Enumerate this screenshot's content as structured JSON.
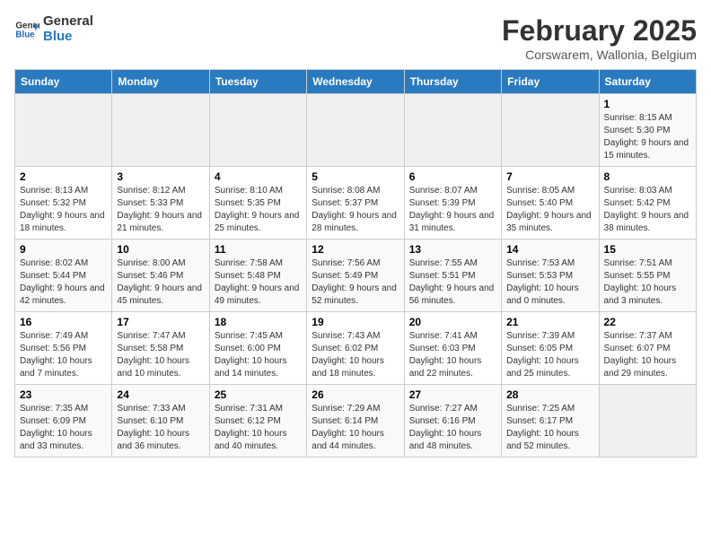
{
  "logo": {
    "line1": "General",
    "line2": "Blue"
  },
  "title": "February 2025",
  "subtitle": "Corswarem, Wallonia, Belgium",
  "days_of_week": [
    "Sunday",
    "Monday",
    "Tuesday",
    "Wednesday",
    "Thursday",
    "Friday",
    "Saturday"
  ],
  "weeks": [
    [
      {
        "day": null,
        "info": null
      },
      {
        "day": null,
        "info": null
      },
      {
        "day": null,
        "info": null
      },
      {
        "day": null,
        "info": null
      },
      {
        "day": null,
        "info": null
      },
      {
        "day": null,
        "info": null
      },
      {
        "day": "1",
        "info": "Sunrise: 8:15 AM\nSunset: 5:30 PM\nDaylight: 9 hours and 15 minutes."
      }
    ],
    [
      {
        "day": "2",
        "info": "Sunrise: 8:13 AM\nSunset: 5:32 PM\nDaylight: 9 hours and 18 minutes."
      },
      {
        "day": "3",
        "info": "Sunrise: 8:12 AM\nSunset: 5:33 PM\nDaylight: 9 hours and 21 minutes."
      },
      {
        "day": "4",
        "info": "Sunrise: 8:10 AM\nSunset: 5:35 PM\nDaylight: 9 hours and 25 minutes."
      },
      {
        "day": "5",
        "info": "Sunrise: 8:08 AM\nSunset: 5:37 PM\nDaylight: 9 hours and 28 minutes."
      },
      {
        "day": "6",
        "info": "Sunrise: 8:07 AM\nSunset: 5:39 PM\nDaylight: 9 hours and 31 minutes."
      },
      {
        "day": "7",
        "info": "Sunrise: 8:05 AM\nSunset: 5:40 PM\nDaylight: 9 hours and 35 minutes."
      },
      {
        "day": "8",
        "info": "Sunrise: 8:03 AM\nSunset: 5:42 PM\nDaylight: 9 hours and 38 minutes."
      }
    ],
    [
      {
        "day": "9",
        "info": "Sunrise: 8:02 AM\nSunset: 5:44 PM\nDaylight: 9 hours and 42 minutes."
      },
      {
        "day": "10",
        "info": "Sunrise: 8:00 AM\nSunset: 5:46 PM\nDaylight: 9 hours and 45 minutes."
      },
      {
        "day": "11",
        "info": "Sunrise: 7:58 AM\nSunset: 5:48 PM\nDaylight: 9 hours and 49 minutes."
      },
      {
        "day": "12",
        "info": "Sunrise: 7:56 AM\nSunset: 5:49 PM\nDaylight: 9 hours and 52 minutes."
      },
      {
        "day": "13",
        "info": "Sunrise: 7:55 AM\nSunset: 5:51 PM\nDaylight: 9 hours and 56 minutes."
      },
      {
        "day": "14",
        "info": "Sunrise: 7:53 AM\nSunset: 5:53 PM\nDaylight: 10 hours and 0 minutes."
      },
      {
        "day": "15",
        "info": "Sunrise: 7:51 AM\nSunset: 5:55 PM\nDaylight: 10 hours and 3 minutes."
      }
    ],
    [
      {
        "day": "16",
        "info": "Sunrise: 7:49 AM\nSunset: 5:56 PM\nDaylight: 10 hours and 7 minutes."
      },
      {
        "day": "17",
        "info": "Sunrise: 7:47 AM\nSunset: 5:58 PM\nDaylight: 10 hours and 10 minutes."
      },
      {
        "day": "18",
        "info": "Sunrise: 7:45 AM\nSunset: 6:00 PM\nDaylight: 10 hours and 14 minutes."
      },
      {
        "day": "19",
        "info": "Sunrise: 7:43 AM\nSunset: 6:02 PM\nDaylight: 10 hours and 18 minutes."
      },
      {
        "day": "20",
        "info": "Sunrise: 7:41 AM\nSunset: 6:03 PM\nDaylight: 10 hours and 22 minutes."
      },
      {
        "day": "21",
        "info": "Sunrise: 7:39 AM\nSunset: 6:05 PM\nDaylight: 10 hours and 25 minutes."
      },
      {
        "day": "22",
        "info": "Sunrise: 7:37 AM\nSunset: 6:07 PM\nDaylight: 10 hours and 29 minutes."
      }
    ],
    [
      {
        "day": "23",
        "info": "Sunrise: 7:35 AM\nSunset: 6:09 PM\nDaylight: 10 hours and 33 minutes."
      },
      {
        "day": "24",
        "info": "Sunrise: 7:33 AM\nSunset: 6:10 PM\nDaylight: 10 hours and 36 minutes."
      },
      {
        "day": "25",
        "info": "Sunrise: 7:31 AM\nSunset: 6:12 PM\nDaylight: 10 hours and 40 minutes."
      },
      {
        "day": "26",
        "info": "Sunrise: 7:29 AM\nSunset: 6:14 PM\nDaylight: 10 hours and 44 minutes."
      },
      {
        "day": "27",
        "info": "Sunrise: 7:27 AM\nSunset: 6:16 PM\nDaylight: 10 hours and 48 minutes."
      },
      {
        "day": "28",
        "info": "Sunrise: 7:25 AM\nSunset: 6:17 PM\nDaylight: 10 hours and 52 minutes."
      },
      {
        "day": null,
        "info": null
      }
    ]
  ]
}
